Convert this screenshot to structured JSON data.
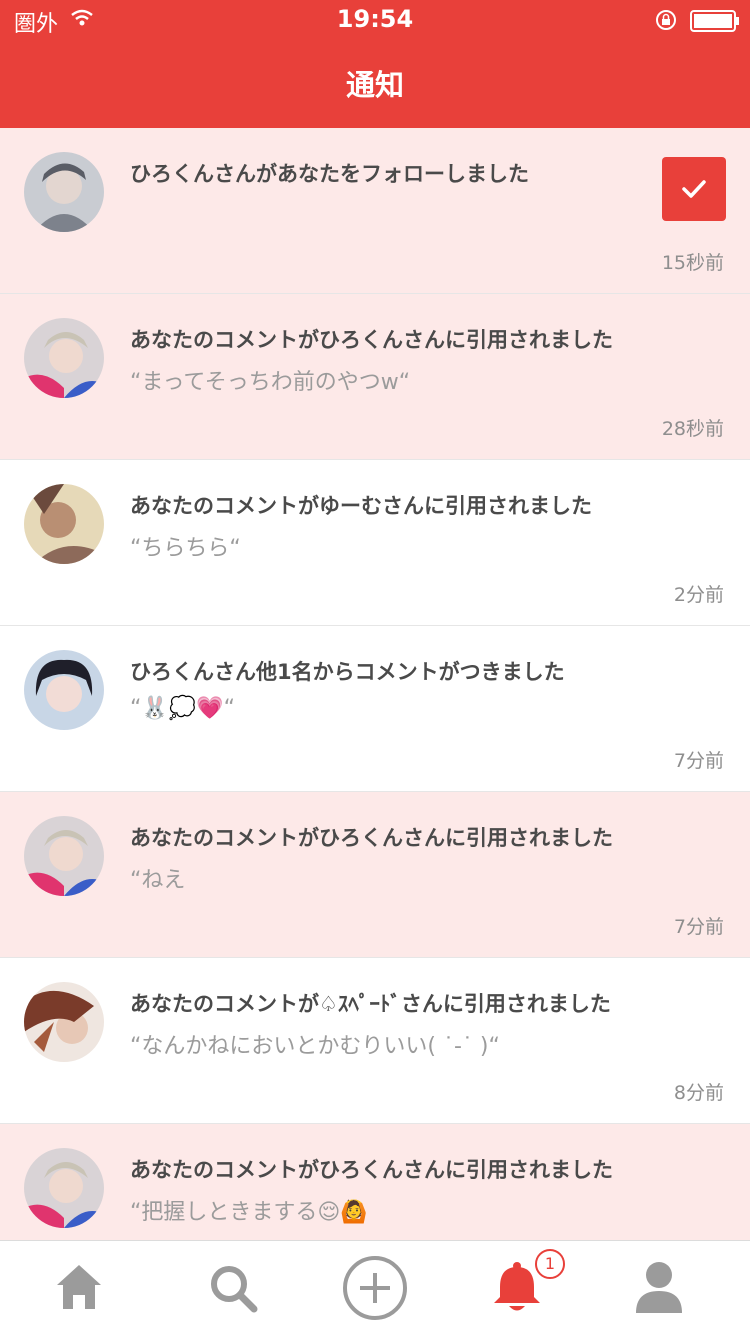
{
  "status_bar": {
    "carrier": "圏外",
    "time": "19:54"
  },
  "header": {
    "title": "通知"
  },
  "notifications": [
    {
      "title": "ひろくんさんがあなたをフォローしました",
      "quote": "",
      "time": "15秒前",
      "read": false,
      "has_follow_check": true
    },
    {
      "title": "あなたのコメントがひろくんさんに引用されました",
      "quote": "“まってそっちわ前のやつw“",
      "time": "28秒前",
      "read": false
    },
    {
      "title": "あなたのコメントがゆーむさんに引用されました",
      "quote": "“ちらちら“",
      "time": "2分前",
      "read": true
    },
    {
      "title": "ひろくんさん他1名からコメントがつきました",
      "quote": "“🐰💭💗“",
      "time": "7分前",
      "read": true
    },
    {
      "title": "あなたのコメントがひろくんさんに引用されました",
      "quote": "“ねえ",
      "time": "7分前",
      "read": false
    },
    {
      "title": "あなたのコメントが♤ｽﾍﾟｰﾄﾞさんに引用されました",
      "quote": "“なんかねにおいとかむりいい(  ˙-˙  )“",
      "time": "8分前",
      "read": true
    },
    {
      "title": "あなたのコメントがひろくんさんに引用されました",
      "quote": "“把握しときまする😌🙆",
      "time": "",
      "read": false
    }
  ],
  "tab_bar": {
    "items": [
      {
        "icon": "home-icon",
        "active": false
      },
      {
        "icon": "search-icon",
        "active": false
      },
      {
        "icon": "add-post-icon",
        "active": false
      },
      {
        "icon": "notification-bell-icon",
        "active": true,
        "badge": "1"
      },
      {
        "icon": "profile-icon",
        "active": false
      }
    ]
  },
  "colors": {
    "accent": "#e8403a",
    "unread_background": "#fde9e8",
    "read_background": "#ffffff",
    "title_text": "#4a4a4a",
    "quote_text": "#9b9b9b",
    "tab_inactive": "#9b9b9b"
  }
}
